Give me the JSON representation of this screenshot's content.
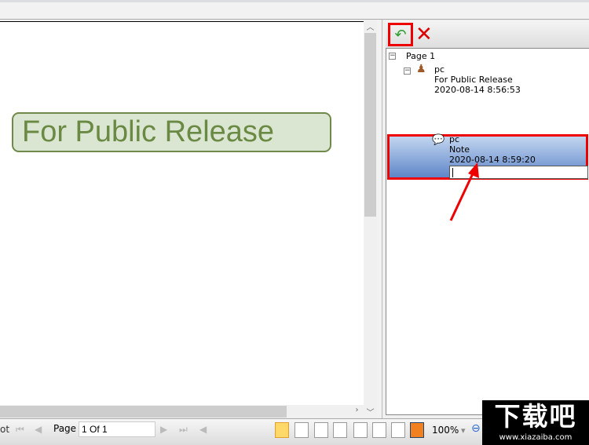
{
  "document": {
    "stamp_text": "For Public Release"
  },
  "panel": {
    "toolbar": {
      "add_icon": "reply-note-icon",
      "delete_icon": "delete-x-icon"
    },
    "tree": {
      "page": "Page 1",
      "items": [
        {
          "author": "pc",
          "subject": "For Public Release",
          "date": "2020-08-14 8:56:53",
          "icon": "stamp-icon"
        },
        {
          "author": "pc",
          "subject": "Note",
          "date": "2020-08-14 8:59:20",
          "icon": "note-comment-icon",
          "selected": true,
          "reply_value": ""
        }
      ]
    }
  },
  "bottom": {
    "left_cut": "ot",
    "page_label": "Page",
    "page_value": "1 Of 1",
    "zoom": "100%"
  },
  "watermark": {
    "logo": "下载吧",
    "url": "www.xiazaiba.com"
  },
  "colors": {
    "highlight": "#ff0000",
    "stamp": "#6f8a4a",
    "selection": "#5f86c8"
  }
}
